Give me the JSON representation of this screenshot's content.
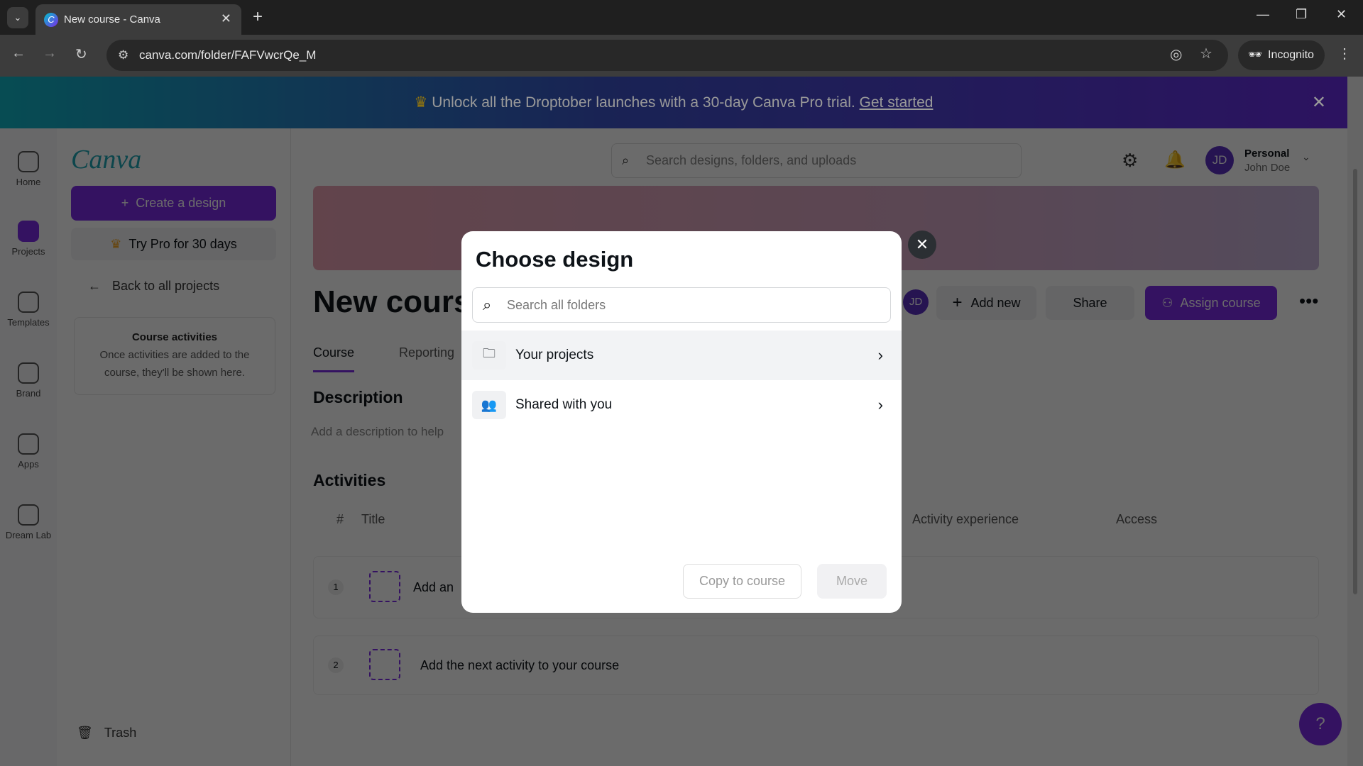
{
  "browser": {
    "tab_title": "New course - Canva",
    "url": "canva.com/folder/FAFVwcrQe_M",
    "incognito_label": "Incognito"
  },
  "banner": {
    "text": "Unlock all the Droptober launches with a 30-day Canva Pro trial.",
    "link": "Get started"
  },
  "rail": [
    {
      "label": "Home"
    },
    {
      "label": "Projects"
    },
    {
      "label": "Templates"
    },
    {
      "label": "Brand"
    },
    {
      "label": "Apps"
    },
    {
      "label": "Dream Lab"
    }
  ],
  "sidebar": {
    "logo": "Canva",
    "create": "Create a design",
    "try_pro": "Try Pro for 30 days",
    "back": "Back to all projects",
    "activities_title": "Course activities",
    "activities_text": "Once activities are added to the course, they'll be shown here.",
    "trash": "Trash"
  },
  "header": {
    "search_placeholder": "Search designs, folders, and uploads",
    "account_type": "Personal",
    "user_name": "John Doe",
    "initials": "JD"
  },
  "main": {
    "title": "New course",
    "add_new": "Add new",
    "share": "Share",
    "assign": "Assign course",
    "tabs": [
      {
        "label": "Course"
      },
      {
        "label": "Reporting"
      }
    ],
    "description_heading": "Description",
    "description_placeholder": "Add a description to help",
    "activities_heading": "Activities",
    "columns": [
      "#",
      "Title",
      "Activity experience",
      "Access"
    ],
    "rows": [
      {
        "num": "1",
        "title": "Add an"
      },
      {
        "num": "2",
        "title": "Add the next activity to your course"
      }
    ]
  },
  "modal": {
    "title": "Choose design",
    "search_placeholder": "Search all folders",
    "items": [
      {
        "label": "Your projects"
      },
      {
        "label": "Shared with you"
      }
    ],
    "copy": "Copy to course",
    "move": "Move"
  },
  "colors": {
    "accent": "#7d2ae8",
    "banner_start": "#0b7f8a",
    "banner_end": "#4a1fa0"
  }
}
